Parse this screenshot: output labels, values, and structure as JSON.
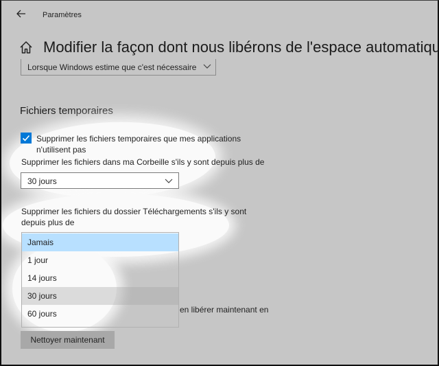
{
  "window": {
    "title": "Paramètres",
    "back_icon": "back-arrow-icon"
  },
  "header": {
    "home_icon": "home-icon",
    "title": "Modifier la façon dont nous libérons de l'espace automatiquement"
  },
  "run_frequency": {
    "selected": "Lorsque Windows estime que c'est nécessaire"
  },
  "temp_files": {
    "section_title": "Fichiers temporaires",
    "checkbox_label": "Supprimer les fichiers temporaires que mes applications n'utilisent pas",
    "checkbox_checked": true,
    "recycle_label": "Supprimer les fichiers dans ma Corbeille s'ils y sont depuis plus de",
    "recycle_selected": "30 jours",
    "downloads_label": "Supprimer les fichiers du dossier Téléchargements s'ils y sont depuis plus de",
    "downloads_options": [
      "Jamais",
      "1 jour",
      "14 jours",
      "30 jours",
      "60 jours"
    ],
    "downloads_selected_index": 0,
    "downloads_hover_index": 3
  },
  "free_now": {
    "text_fragment": "en libérer maintenant en",
    "button_label": "Nettoyer maintenant"
  },
  "colors": {
    "accent": "#0078d7",
    "selected_option": "#b8e0ff",
    "background": "#c6c6c6"
  }
}
